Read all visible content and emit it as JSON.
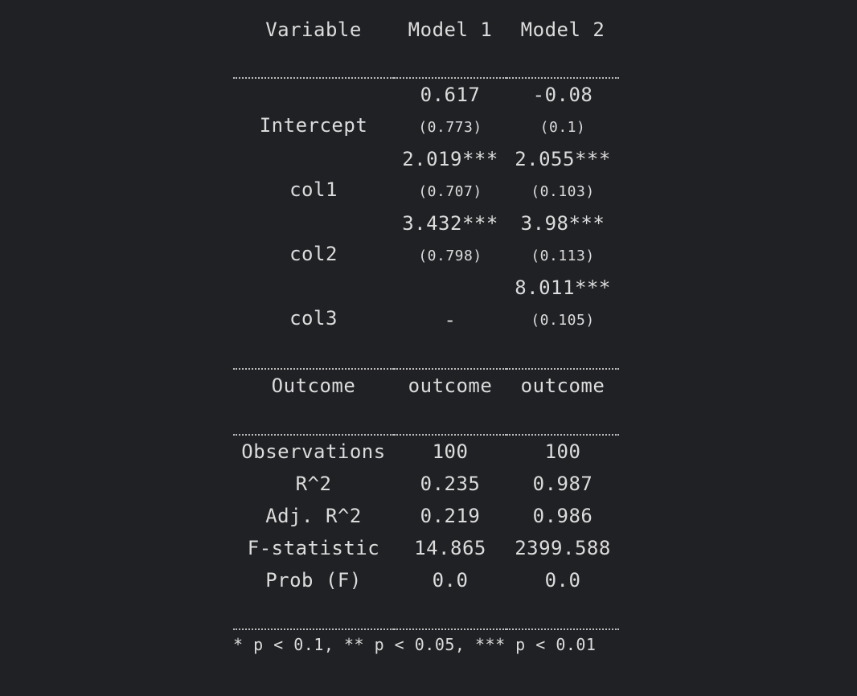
{
  "header": {
    "variable": "Variable",
    "model1": "Model 1",
    "model2": "Model 2"
  },
  "rows": [
    {
      "name": "Intercept",
      "m1": "0.617",
      "m1_se": "(0.773)",
      "m2": "-0.08",
      "m2_se": "(0.1)"
    },
    {
      "name": "col1",
      "m1": "2.019***",
      "m1_se": "(0.707)",
      "m2": "2.055***",
      "m2_se": "(0.103)"
    },
    {
      "name": "col2",
      "m1": "3.432***",
      "m1_se": "(0.798)",
      "m2": "3.98***",
      "m2_se": "(0.113)"
    },
    {
      "name": "col3",
      "m1": "",
      "m1_se": "-",
      "m2": "8.011***",
      "m2_se": "(0.105)"
    }
  ],
  "outcome": {
    "label": "Outcome",
    "m1": "outcome",
    "m2": "outcome"
  },
  "stats": [
    {
      "label": "Observations",
      "m1": "100",
      "m2": "100"
    },
    {
      "label": "R^2",
      "m1": "0.235",
      "m2": "0.987"
    },
    {
      "label": "Adj. R^2",
      "m1": "0.219",
      "m2": "0.986"
    },
    {
      "label": "F-statistic",
      "m1": "14.865",
      "m2": "2399.588"
    },
    {
      "label": "Prob (F)",
      "m1": "0.0",
      "m2": "0.0"
    }
  ],
  "footnote": "* p < 0.1, ** p < 0.05, *** p < 0.01",
  "colors": {
    "background": "#202124",
    "text": "#dcdcdc",
    "rule": "#bdbdbd"
  }
}
